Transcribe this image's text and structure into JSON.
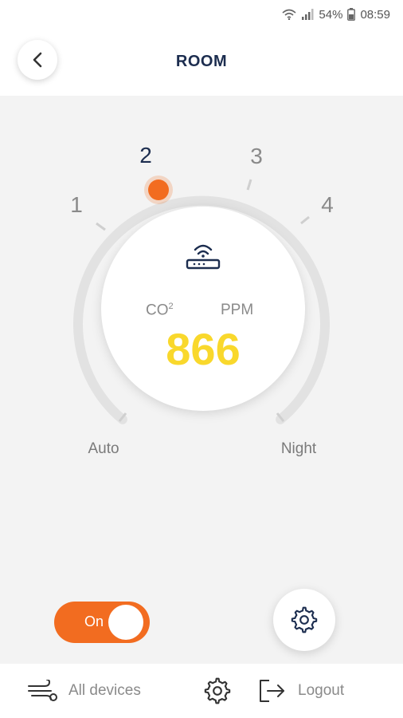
{
  "status_bar": {
    "battery": "54%",
    "time": "08:59",
    "icons": [
      "wifi-icon",
      "signal-icon",
      "battery-icon"
    ]
  },
  "header": {
    "title": "ROOM",
    "back_icon": "chevron-left-icon"
  },
  "dial": {
    "steps": [
      "1",
      "2",
      "3",
      "4"
    ],
    "active_step": "2",
    "modes": [
      "Auto",
      "Night"
    ],
    "accent_color": "#f26c20",
    "center": {
      "device_icon": "router-icon",
      "gas_label": "CO",
      "gas_subscript": "2",
      "unit": "PPM",
      "value": "866",
      "value_color": "#f9d82c"
    }
  },
  "controls": {
    "power_toggle": {
      "label": "On",
      "state": "on",
      "color": "#f26c20"
    },
    "settings_icon": "gear-icon"
  },
  "bottom_nav": {
    "all_devices": {
      "label": "All devices",
      "icon": "fan-icon"
    },
    "settings": {
      "icon": "gear-icon"
    },
    "logout": {
      "label": "Logout",
      "icon": "logout-icon"
    }
  }
}
